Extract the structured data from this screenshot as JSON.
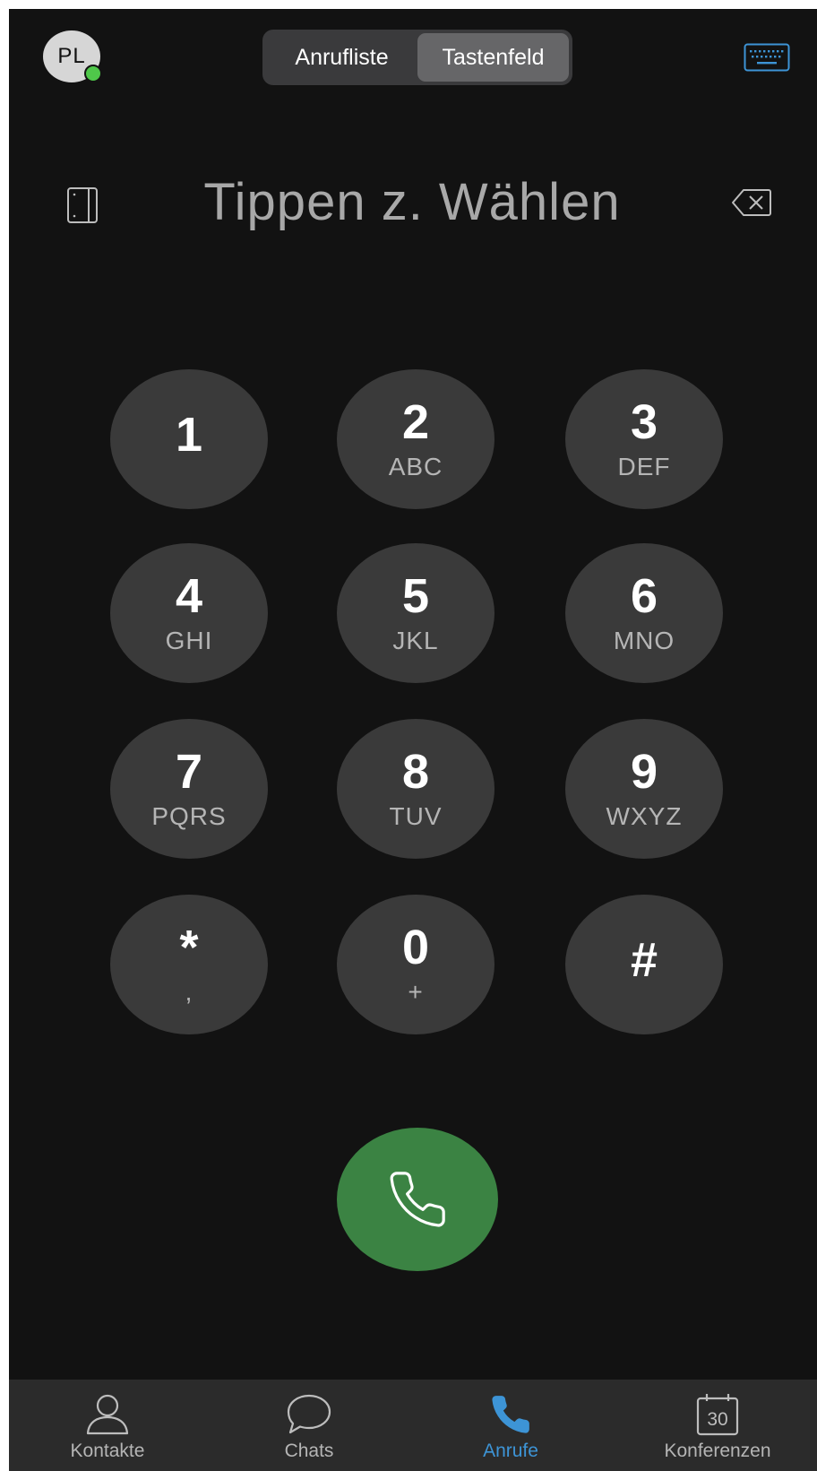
{
  "header": {
    "avatar_initials": "PL",
    "presence_color": "#4fc84a",
    "segments": [
      {
        "label": "Anrufliste",
        "active": false
      },
      {
        "label": "Tastenfeld",
        "active": true
      }
    ],
    "keyboard_icon": "keyboard-icon"
  },
  "display": {
    "placeholder": "Tippen z. Wählen",
    "left_icon": "sim-icon",
    "right_icon": "backspace-icon"
  },
  "keypad": {
    "keys": [
      {
        "digit": "1",
        "letters": ""
      },
      {
        "digit": "2",
        "letters": "ABC"
      },
      {
        "digit": "3",
        "letters": "DEF"
      },
      {
        "digit": "4",
        "letters": "GHI"
      },
      {
        "digit": "5",
        "letters": "JKL"
      },
      {
        "digit": "6",
        "letters": "MNO"
      },
      {
        "digit": "7",
        "letters": "PQRS"
      },
      {
        "digit": "8",
        "letters": "TUV"
      },
      {
        "digit": "9",
        "letters": "WXYZ"
      },
      {
        "digit": "*",
        "letters": ","
      },
      {
        "digit": "0",
        "letters": "+"
      },
      {
        "digit": "#",
        "letters": ""
      }
    ]
  },
  "call_button": {
    "icon": "phone-icon",
    "color": "#3b8343"
  },
  "tabbar": {
    "accent_color": "#3d94d6",
    "tabs": [
      {
        "label": "Kontakte",
        "icon": "person-icon",
        "active": false
      },
      {
        "label": "Chats",
        "icon": "chat-bubble-icon",
        "active": false
      },
      {
        "label": "Anrufe",
        "icon": "phone-icon",
        "active": true
      },
      {
        "label": "Konferenzen",
        "icon": "calendar-icon",
        "active": false,
        "badge_text": "30"
      }
    ]
  }
}
